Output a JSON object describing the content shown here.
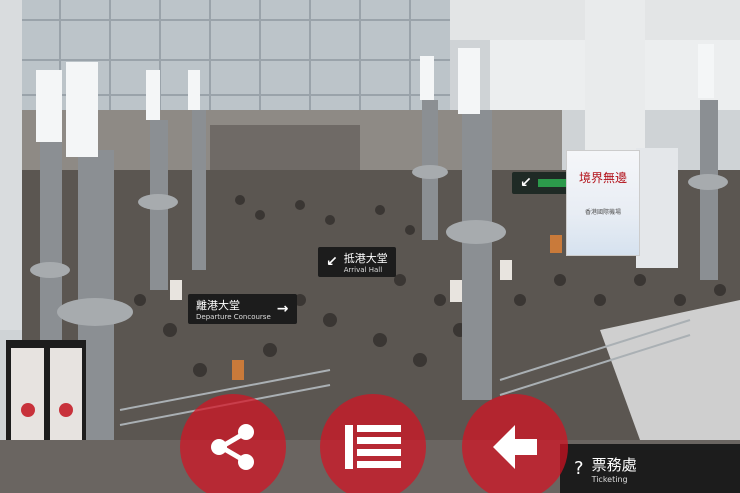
{
  "scene": {
    "signs": [
      {
        "zh": "離港大堂",
        "en": "Departure Concourse",
        "arrow": "→"
      },
      {
        "zh": "抵港大堂",
        "en": "Arrival Hall",
        "arrow": "↙"
      },
      {
        "zh": "",
        "en": "",
        "arrow": "↙"
      }
    ],
    "banner": {
      "title": "境界無邊",
      "subtitle": "香港國際機場"
    },
    "ticket": {
      "zh": "票務處",
      "en": "Ticketing"
    }
  },
  "overlay": {
    "buttons": [
      {
        "icon": "share-icon"
      },
      {
        "icon": "list-icon"
      },
      {
        "icon": "back-arrow-icon"
      }
    ],
    "color": "#d61223"
  }
}
